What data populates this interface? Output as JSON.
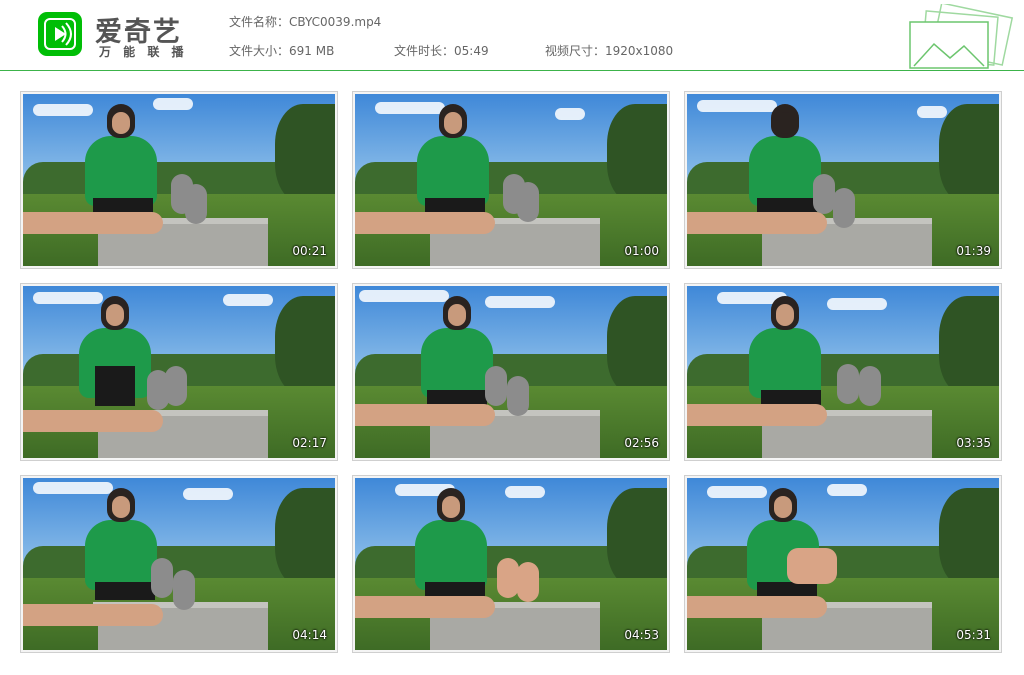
{
  "brand": {
    "name": "爱奇艺",
    "tagline": "万 能 联 播",
    "accent_color": "#00be06"
  },
  "file_info": {
    "name_label": "文件名称：",
    "name_value": "CBYC0039.mp4",
    "size_label": "文件大小：",
    "size_value": "691 MB",
    "duration_label": "文件时长：",
    "duration_value": "05:49",
    "resolution_label": "视频尺寸：",
    "resolution_value": "1920x1080"
  },
  "thumbnails": [
    {
      "time": "00:21"
    },
    {
      "time": "01:00"
    },
    {
      "time": "01:39"
    },
    {
      "time": "02:17"
    },
    {
      "time": "02:56"
    },
    {
      "time": "03:35"
    },
    {
      "time": "04:14"
    },
    {
      "time": "04:53"
    },
    {
      "time": "05:31"
    }
  ]
}
